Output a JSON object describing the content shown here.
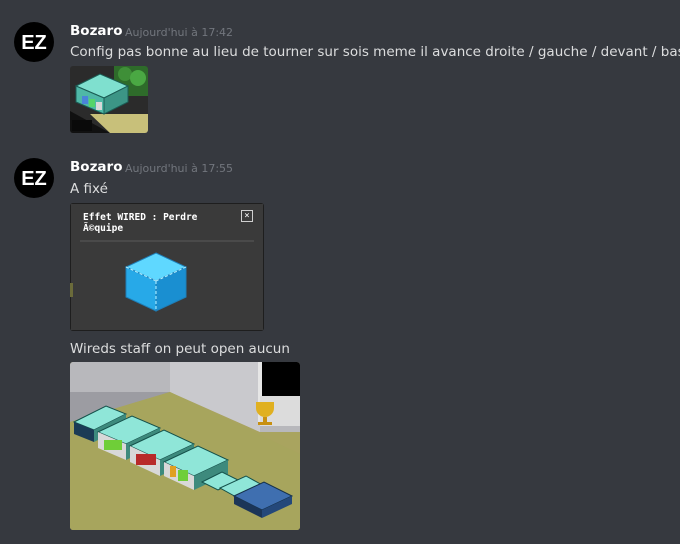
{
  "messages": [
    {
      "author": "Bozaro",
      "avatar_text": "EZ",
      "timestamp": "Aujourd'hui à 17:42",
      "text": "Config pas bonne au lieu de tourner sur sois meme il avance droite / gauche / devant / bas"
    },
    {
      "author": "Bozaro",
      "avatar_text": "EZ",
      "timestamp": "Aujourd'hui à 17:55",
      "text": "A fixé",
      "text2": "Wireds staff on peut open aucun"
    }
  ],
  "wired_dialog": {
    "title": "Effet WIRED : Perdre Ã©quipe",
    "close_glyph": "×"
  },
  "icons": [
    "close-icon"
  ],
  "colors": {
    "background": "#36393f",
    "author": "#ffffff",
    "timestamp": "#72767d",
    "text": "#dcddde"
  }
}
